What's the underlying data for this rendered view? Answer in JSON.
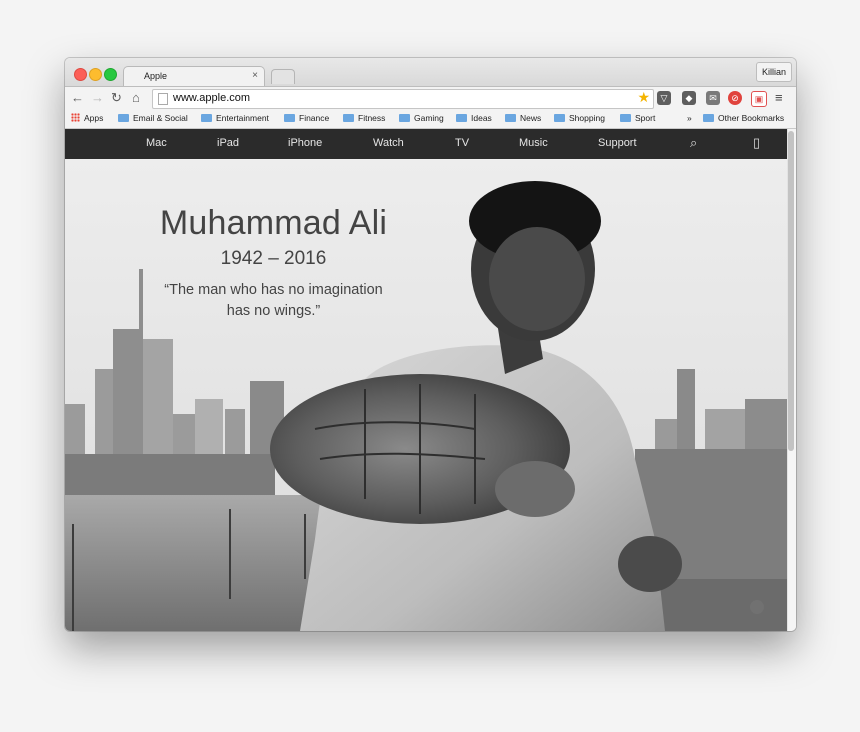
{
  "browser": {
    "tab_title": "Apple",
    "profile_name": "Killian",
    "url": "www.apple.com",
    "bookmarks": [
      "Apps",
      "Email & Social",
      "Entertainment",
      "Finance",
      "Fitness",
      "Gaming",
      "Ideas",
      "News",
      "Shopping",
      "Sport"
    ],
    "overflow_glyph": "»",
    "other_bookmarks": "Other Bookmarks"
  },
  "site_nav": {
    "items": [
      "Mac",
      "iPad",
      "iPhone",
      "Watch",
      "TV",
      "Music",
      "Support"
    ]
  },
  "hero": {
    "headline": "Muhammad Ali",
    "years": "1942 – 2016",
    "quote_line1": "“The man who has no imagination",
    "quote_line2": "has no wings.”"
  },
  "colors": {
    "nav_background": "#2b2b2b",
    "folder_blue": "#6aa6e0"
  }
}
